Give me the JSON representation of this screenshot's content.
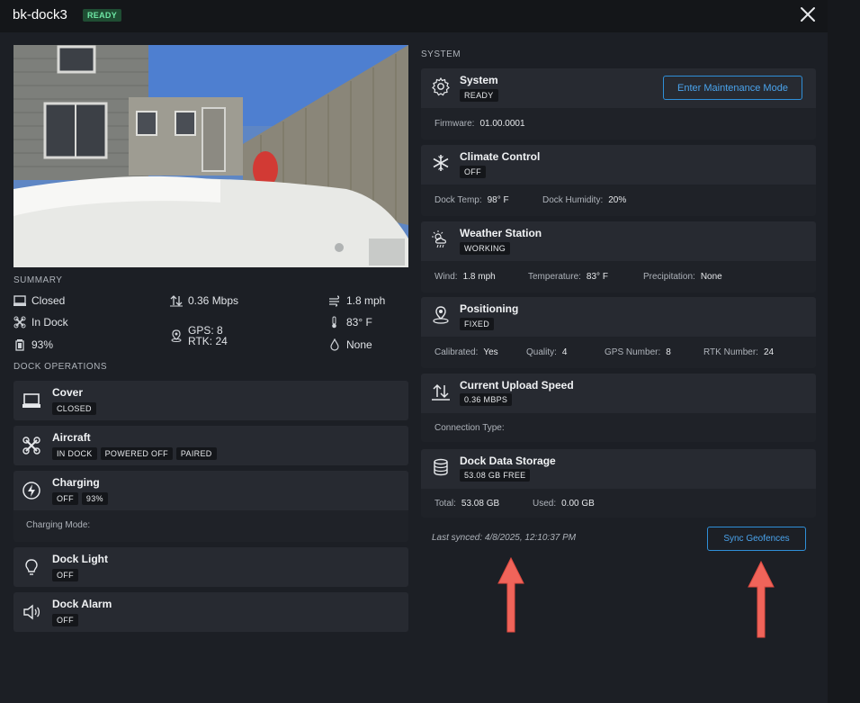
{
  "header": {
    "title": "bk-dock3",
    "status": "READY"
  },
  "summary": {
    "label": "SUMMARY",
    "cover": "Closed",
    "aircraft": "In Dock",
    "battery": "93%",
    "upload_speed": "0.36 Mbps",
    "gps": "GPS: 8",
    "rtk": "RTK: 24",
    "wind": "1.8 mph",
    "temperature": "83° F",
    "precipitation": "None"
  },
  "dock_operations": {
    "label": "DOCK OPERATIONS",
    "cover": {
      "title": "Cover",
      "tags": [
        "CLOSED"
      ]
    },
    "aircraft": {
      "title": "Aircraft",
      "tags": [
        "IN DOCK",
        "POWERED OFF",
        "PAIRED"
      ]
    },
    "charging": {
      "title": "Charging",
      "tags": [
        "OFF",
        "93%"
      ],
      "mode_label": "Charging Mode:"
    },
    "dock_light": {
      "title": "Dock Light",
      "tags": [
        "OFF"
      ]
    },
    "dock_alarm": {
      "title": "Dock Alarm",
      "tags": [
        "OFF"
      ]
    }
  },
  "system": {
    "label": "SYSTEM",
    "system": {
      "title": "System",
      "status": "READY",
      "firmware_label": "Firmware:",
      "firmware_value": "01.00.0001",
      "maintenance_button": "Enter Maintenance Mode"
    },
    "climate": {
      "title": "Climate Control",
      "status": "OFF",
      "temp_label": "Dock Temp:",
      "temp_value": "98° F",
      "humidity_label": "Dock Humidity:",
      "humidity_value": "20%"
    },
    "weather": {
      "title": "Weather Station",
      "status": "WORKING",
      "wind_label": "Wind:",
      "wind_value": "1.8 mph",
      "temp_label": "Temperature:",
      "temp_value": "83° F",
      "precip_label": "Precipitation:",
      "precip_value": "None"
    },
    "positioning": {
      "title": "Positioning",
      "status": "FIXED",
      "calibrated_label": "Calibrated:",
      "calibrated_value": "Yes",
      "quality_label": "Quality:",
      "quality_value": "4",
      "gps_label": "GPS Number:",
      "gps_value": "8",
      "rtk_label": "RTK Number:",
      "rtk_value": "24"
    },
    "upload": {
      "title": "Current Upload Speed",
      "status": "0.36 MBPS",
      "connection_label": "Connection Type:"
    },
    "storage": {
      "title": "Dock Data Storage",
      "status": "53.08 GB FREE",
      "total_label": "Total:",
      "total_value": "53.08 GB",
      "used_label": "Used:",
      "used_value": "0.00 GB"
    }
  },
  "footer": {
    "last_synced": "Last synced: 4/8/2025, 12:10:37 PM",
    "sync_button": "Sync Geofences"
  },
  "colors": {
    "accent": "#2f8fd8",
    "ready_bg": "#1f4d33",
    "ready_text": "#6ee7a5",
    "annotation_arrow": "#f0645a"
  }
}
